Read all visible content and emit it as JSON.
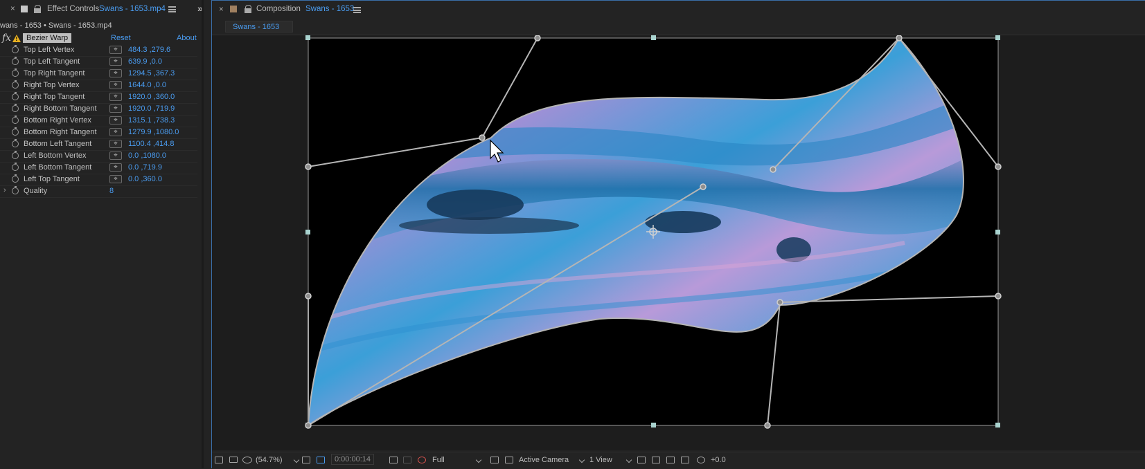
{
  "effect_controls": {
    "close_glyph": "×",
    "tab_title_prefix": "Effect Controls",
    "tab_title_layer": "Swans - 1653.mp4",
    "layer_path": "wans - 1653 • Swans - 1653.mp4",
    "effect": {
      "fx_label": "fx",
      "name": "Bezier Warp",
      "reset_label": "Reset",
      "about_label": "About"
    },
    "properties": [
      {
        "label": "Top Left Vertex",
        "value": "484.3 ,279.6"
      },
      {
        "label": "Top Left Tangent",
        "value": "639.9 ,0.0"
      },
      {
        "label": "Top Right Tangent",
        "value": "1294.5 ,367.3"
      },
      {
        "label": "Right Top Vertex",
        "value": "1644.0 ,0.0"
      },
      {
        "label": "Right Top Tangent",
        "value": "1920.0 ,360.0"
      },
      {
        "label": "Right Bottom Tangent",
        "value": "1920.0 ,719.9"
      },
      {
        "label": "Bottom Right Vertex",
        "value": "1315.1 ,738.3"
      },
      {
        "label": "Bottom Right Tangent",
        "value": "1279.9 ,1080.0"
      },
      {
        "label": "Bottom Left Tangent",
        "value": "1100.4 ,414.8"
      },
      {
        "label": "Left Bottom Vertex",
        "value": "0.0 ,1080.0"
      },
      {
        "label": "Left Bottom Tangent",
        "value": "0.0 ,719.9"
      },
      {
        "label": "Left Top Tangent",
        "value": "0.0 ,360.0"
      }
    ],
    "quality": {
      "label": "Quality",
      "value": "8"
    }
  },
  "composition": {
    "close_glyph": "×",
    "tab_title_prefix": "Composition",
    "tab_title_name": "Swans - 1653",
    "subtab_label": "Swans - 1653",
    "viewer_icons": [
      "cursor-icon",
      "anchor-point-icon"
    ],
    "bottom_bar": {
      "zoom": "(54.7%)",
      "timecode": "0:00:00:14",
      "resolution": "Full",
      "camera": "Active Camera",
      "view_layout": "1 View",
      "exposure": "+0.0"
    }
  },
  "colors": {
    "accent": "#4a9cf0",
    "panel_bg": "#232323",
    "warning": "#e8b020"
  }
}
